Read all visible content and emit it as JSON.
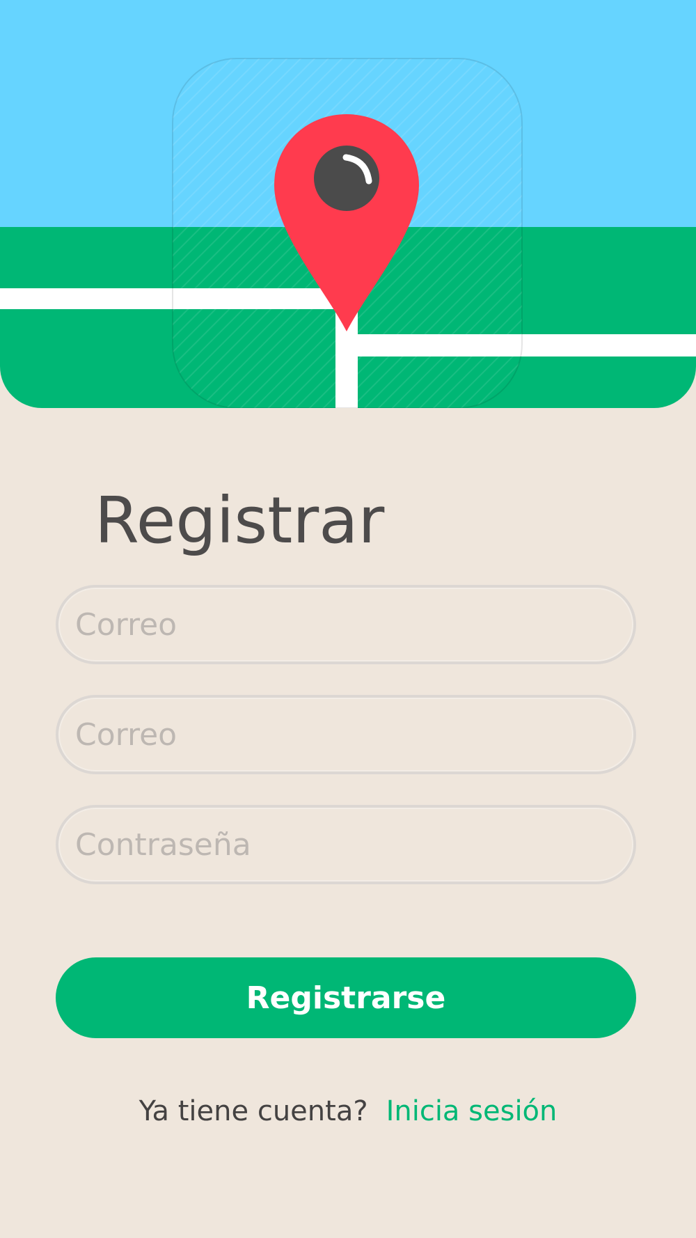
{
  "colors": {
    "sky": "#66d4ff",
    "grass": "#00b775",
    "road": "#ffffff",
    "pin": "#ff3b4e",
    "pin_dot": "#4b4b4b",
    "background": "#efe6dc",
    "primary": "#00b775",
    "title_text": "#4d4b4b",
    "placeholder_text": "#bdb7b2"
  },
  "hero": {
    "icon": "map-pin-icon"
  },
  "title": "Registrar",
  "form": {
    "fields": [
      {
        "placeholder": "Correo",
        "value": ""
      },
      {
        "placeholder": "Correo",
        "value": ""
      },
      {
        "placeholder": "Contraseña",
        "value": ""
      }
    ],
    "submit_label": "Registrarse"
  },
  "footer": {
    "question": "Ya tiene cuenta?",
    "link_label": "Inicia sesión"
  }
}
